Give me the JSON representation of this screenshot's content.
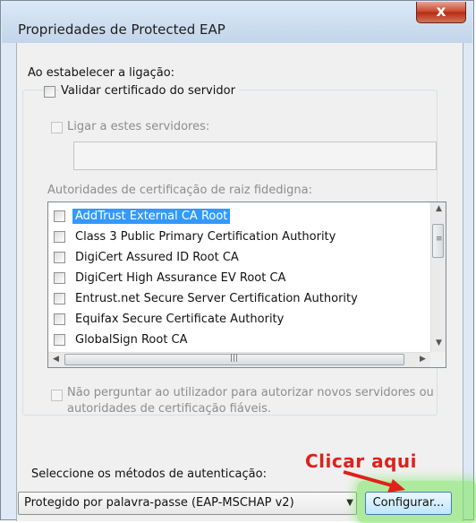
{
  "window": {
    "title": "Propriedades de Protected EAP",
    "close_glyph": "x"
  },
  "connection": {
    "heading": "Ao estabelecer a ligação:",
    "validate_label": "Validar certificado do servidor",
    "connect_servers_label": "Ligar a estes servidores:",
    "servers_value": "",
    "trusted_roots_label": "Autoridades de certificação de raiz fidedigna:"
  },
  "cert_list": [
    {
      "label": "AddTrust External CA Root",
      "checked": false,
      "selected": true
    },
    {
      "label": "Class 3 Public Primary Certification Authority",
      "checked": false,
      "selected": false
    },
    {
      "label": "DigiCert Assured ID Root CA",
      "checked": false,
      "selected": false
    },
    {
      "label": "DigiCert High Assurance EV Root CA",
      "checked": false,
      "selected": false
    },
    {
      "label": "Entrust.net Secure Server Certification Authority",
      "checked": false,
      "selected": false
    },
    {
      "label": "Equifax Secure Certificate Authority",
      "checked": false,
      "selected": false
    },
    {
      "label": "GlobalSign Root CA",
      "checked": false,
      "selected": false
    }
  ],
  "no_prompt": {
    "line1": "Não perguntar ao utilizador para autorizar novos servidores ou",
    "line2": "autoridades de certificação fiáveis."
  },
  "auth": {
    "label": "Seleccione os métodos de autenticação:",
    "selected_method": "Protegido por palavra-passe (EAP-MSCHAP v2)",
    "configure_label": "Configurar..."
  },
  "annotation": {
    "text": "Clicar aqui",
    "color": "#e0201a",
    "highlight_color": "#78e65a"
  },
  "colors": {
    "selection": "#3399ff",
    "button_border": "#3c7fb1"
  }
}
